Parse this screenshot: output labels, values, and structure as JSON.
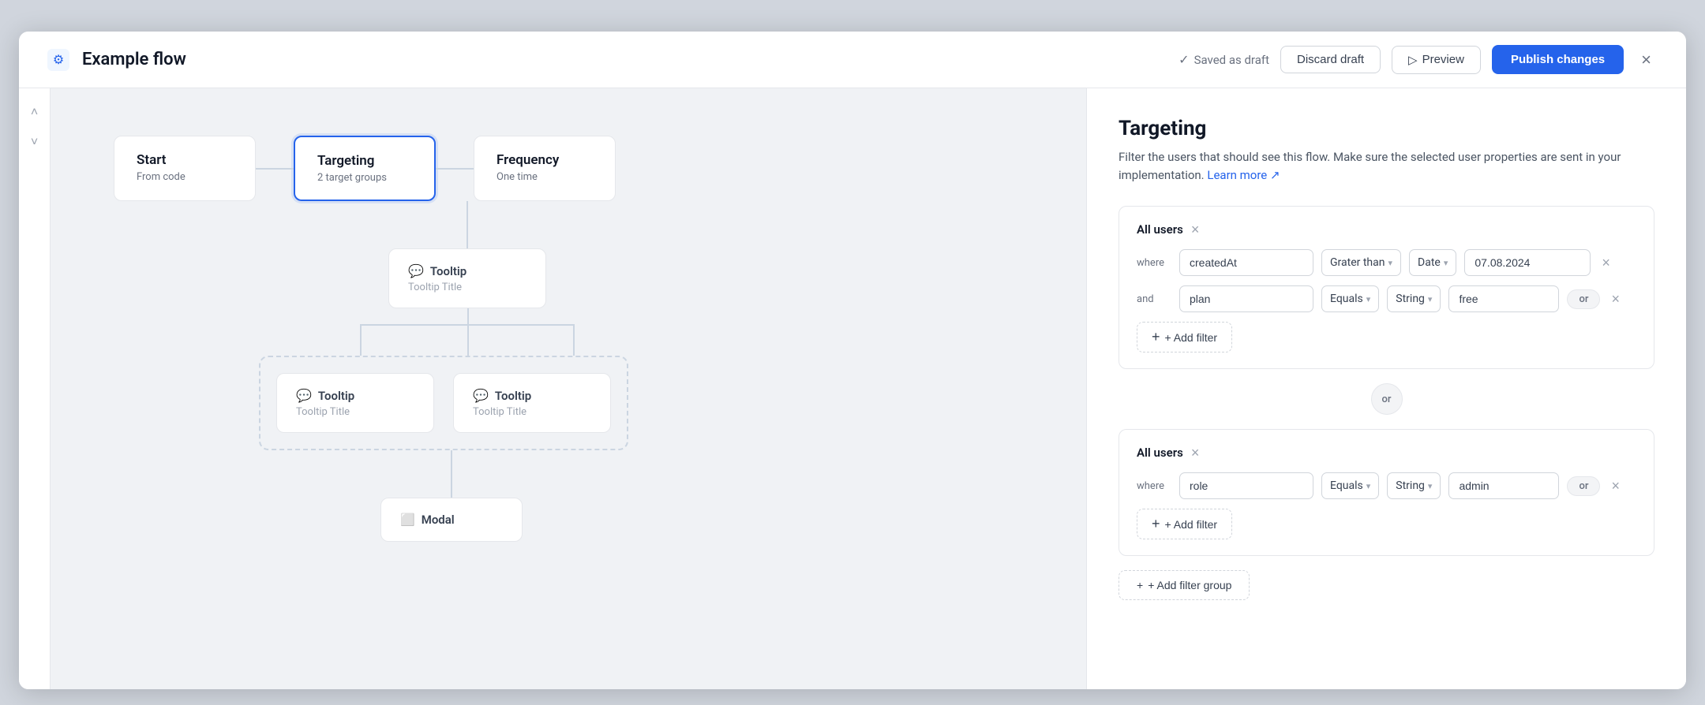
{
  "app": {
    "title": "Example flow"
  },
  "header": {
    "saved_status": "Saved as draft",
    "discard_label": "Discard draft",
    "preview_label": "Preview",
    "publish_label": "Publish changes",
    "close_label": "×"
  },
  "flow": {
    "nodes": {
      "start": {
        "label": "Start",
        "sub": "From code"
      },
      "targeting": {
        "label": "Targeting",
        "sub": "2 target groups"
      },
      "frequency": {
        "label": "Frequency",
        "sub": "One time"
      },
      "tooltip1": {
        "label": "Tooltip",
        "sub": "Tooltip Title"
      },
      "tooltip2": {
        "label": "Tooltip",
        "sub": "Tooltip Title"
      },
      "tooltip3": {
        "label": "Tooltip",
        "sub": "Tooltip Title"
      },
      "modal": {
        "label": "Modal",
        "sub": ""
      }
    }
  },
  "panel": {
    "title": "Targeting",
    "description": "Filter the users that should see this flow. Make sure the selected user properties are sent in your implementation.",
    "learn_more": "Learn more ↗",
    "group1": {
      "label": "All users",
      "filter1": {
        "connector": "where",
        "field": "createdAt",
        "operator": "Grater than",
        "type": "Date",
        "value": "07.08.2024"
      },
      "filter2": {
        "connector": "and",
        "field": "plan",
        "operator": "Equals",
        "type": "String",
        "value": "free"
      },
      "add_filter_label": "+ Add filter"
    },
    "or_label": "or",
    "group2": {
      "label": "All users",
      "filter1": {
        "connector": "where",
        "field": "role",
        "operator": "Equals",
        "type": "String",
        "value": "admin"
      },
      "add_filter_label": "+ Add filter"
    },
    "add_filter_group_label": "+ Add filter group"
  }
}
